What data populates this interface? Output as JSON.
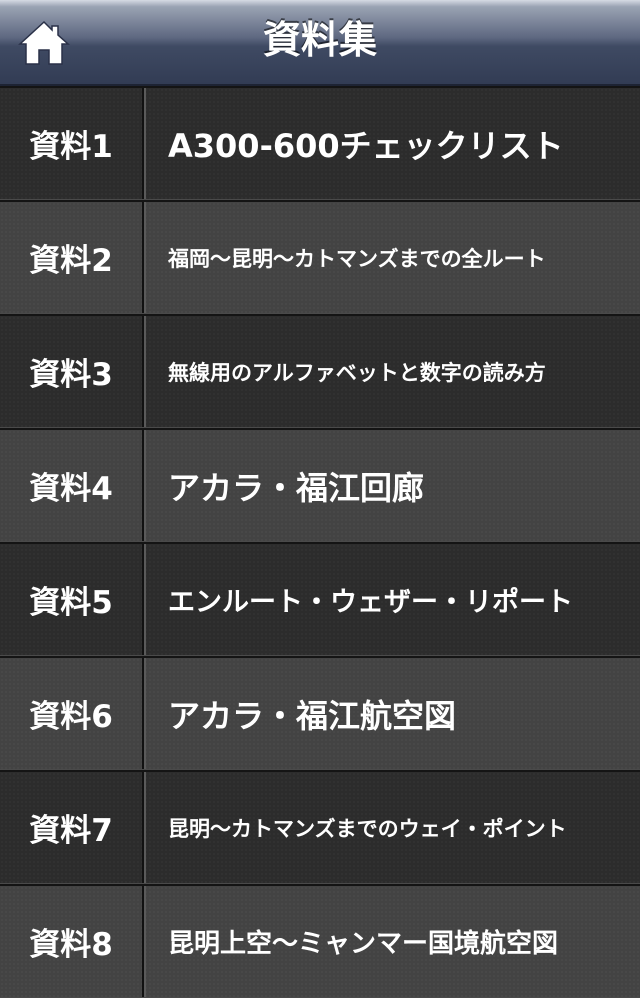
{
  "header": {
    "title": "資料集",
    "home_icon": "home-icon"
  },
  "items": [
    {
      "label": "資料1",
      "title": "A300-600チェックリスト"
    },
    {
      "label": "資料2",
      "title": "福岡〜昆明〜カトマンズまでの全ルート"
    },
    {
      "label": "資料3",
      "title": "無線用のアルファベットと数字の読み方"
    },
    {
      "label": "資料4",
      "title": "アカラ・福江回廊"
    },
    {
      "label": "資料5",
      "title": "エンルート・ウェザー・リポート"
    },
    {
      "label": "資料6",
      "title": "アカラ・福江航空図"
    },
    {
      "label": "資料7",
      "title": "昆明〜カトマンズまでのウェイ・ポイント"
    },
    {
      "label": "資料8",
      "title": "昆明上空〜ミャンマー国境航空図"
    }
  ]
}
